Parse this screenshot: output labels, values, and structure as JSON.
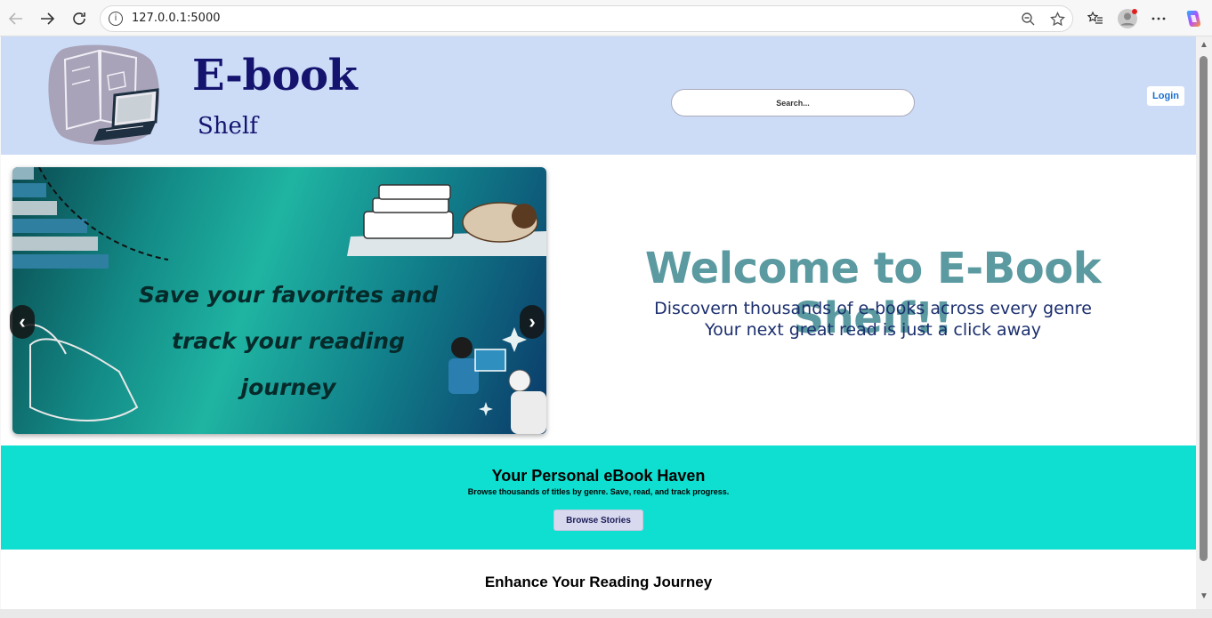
{
  "browser": {
    "url": "127.0.0.1:5000",
    "info_glyph": "i",
    "icons": [
      "back-icon",
      "forward-icon",
      "refresh-icon",
      "info-icon",
      "zoom-out-icon",
      "star-icon",
      "favorites-icon",
      "profile-icon",
      "more-icon",
      "copilot-icon"
    ]
  },
  "header": {
    "brand_title": "E-book",
    "brand_subtitle": "Shelf",
    "search_placeholder": "Search...",
    "login_label": "Login",
    "background": "#ccdcf7"
  },
  "carousel": {
    "caption_line1": "Save your favorites and",
    "caption_line2": "track your reading journey",
    "prev_label": "‹",
    "next_label": "›"
  },
  "welcome": {
    "title": "Welcome to E-Book Shelf!!",
    "line1": "Discovern thousands of e-books across every genre",
    "line2": "Your next great read is just a click away"
  },
  "haven": {
    "title": "Your Personal eBook Haven",
    "subtitle": "Browse thousands of titles by genre. Save, read, and track progress.",
    "button_label": "Browse Stories",
    "background": "#0fdfd0"
  },
  "enhance": {
    "title": "Enhance Your Reading Journey"
  }
}
